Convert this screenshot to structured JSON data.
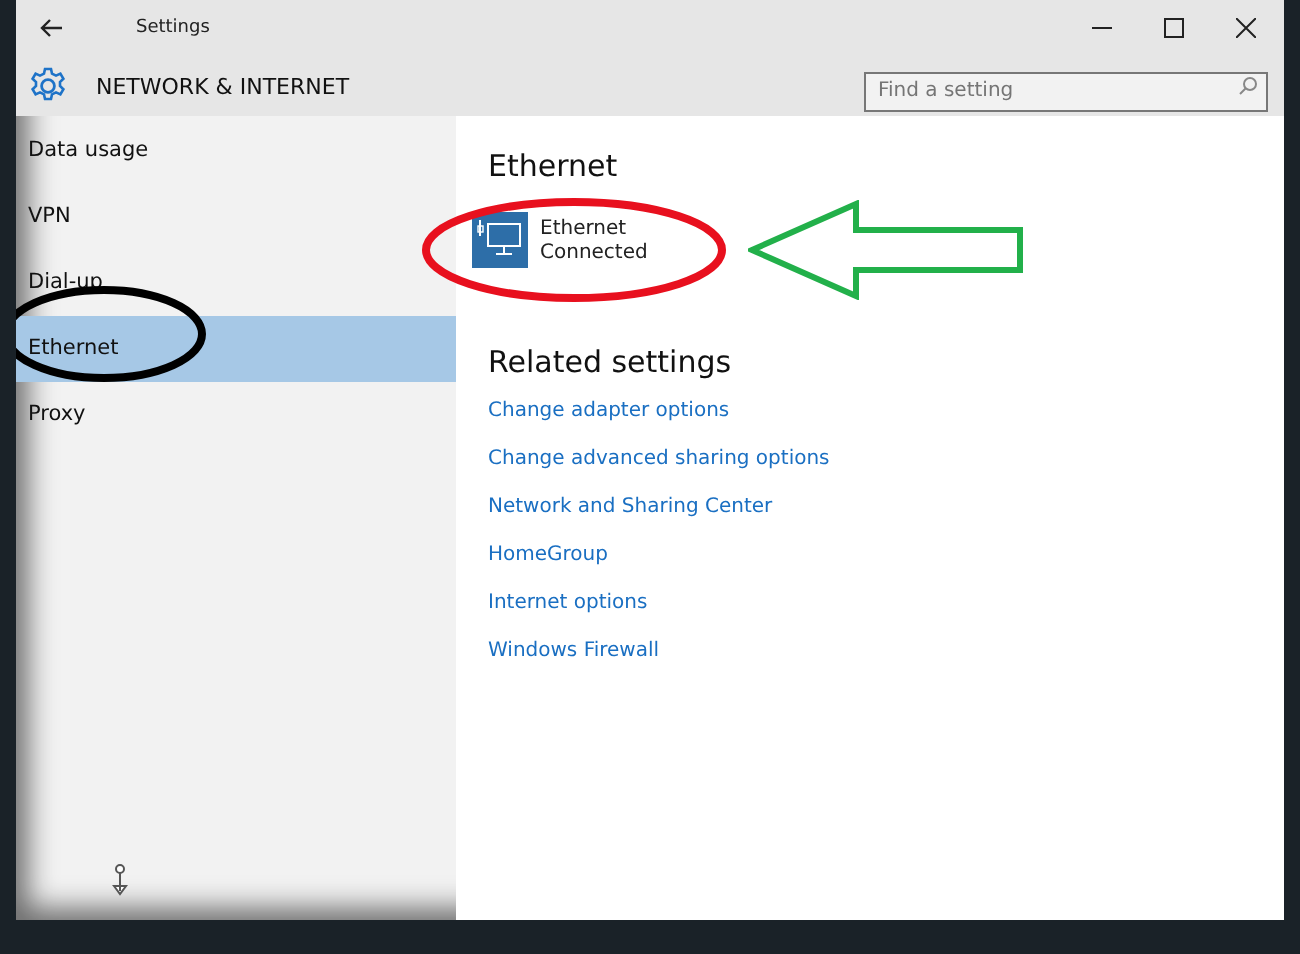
{
  "window": {
    "title": "Settings"
  },
  "header": {
    "title": "NETWORK & INTERNET",
    "search": {
      "placeholder": "Find a setting"
    }
  },
  "sidebar": {
    "items": [
      {
        "label": "Data usage",
        "selected": false
      },
      {
        "label": "VPN",
        "selected": false
      },
      {
        "label": "Dial-up",
        "selected": false
      },
      {
        "label": "Ethernet",
        "selected": true
      },
      {
        "label": "Proxy",
        "selected": false
      }
    ]
  },
  "content": {
    "heading": "Ethernet",
    "connection": {
      "name": "Ethernet",
      "status": "Connected"
    },
    "related_heading": "Related settings",
    "links": [
      "Change adapter options",
      "Change advanced sharing options",
      "Network and Sharing Center",
      "HomeGroup",
      "Internet options",
      "Windows Firewall"
    ]
  }
}
